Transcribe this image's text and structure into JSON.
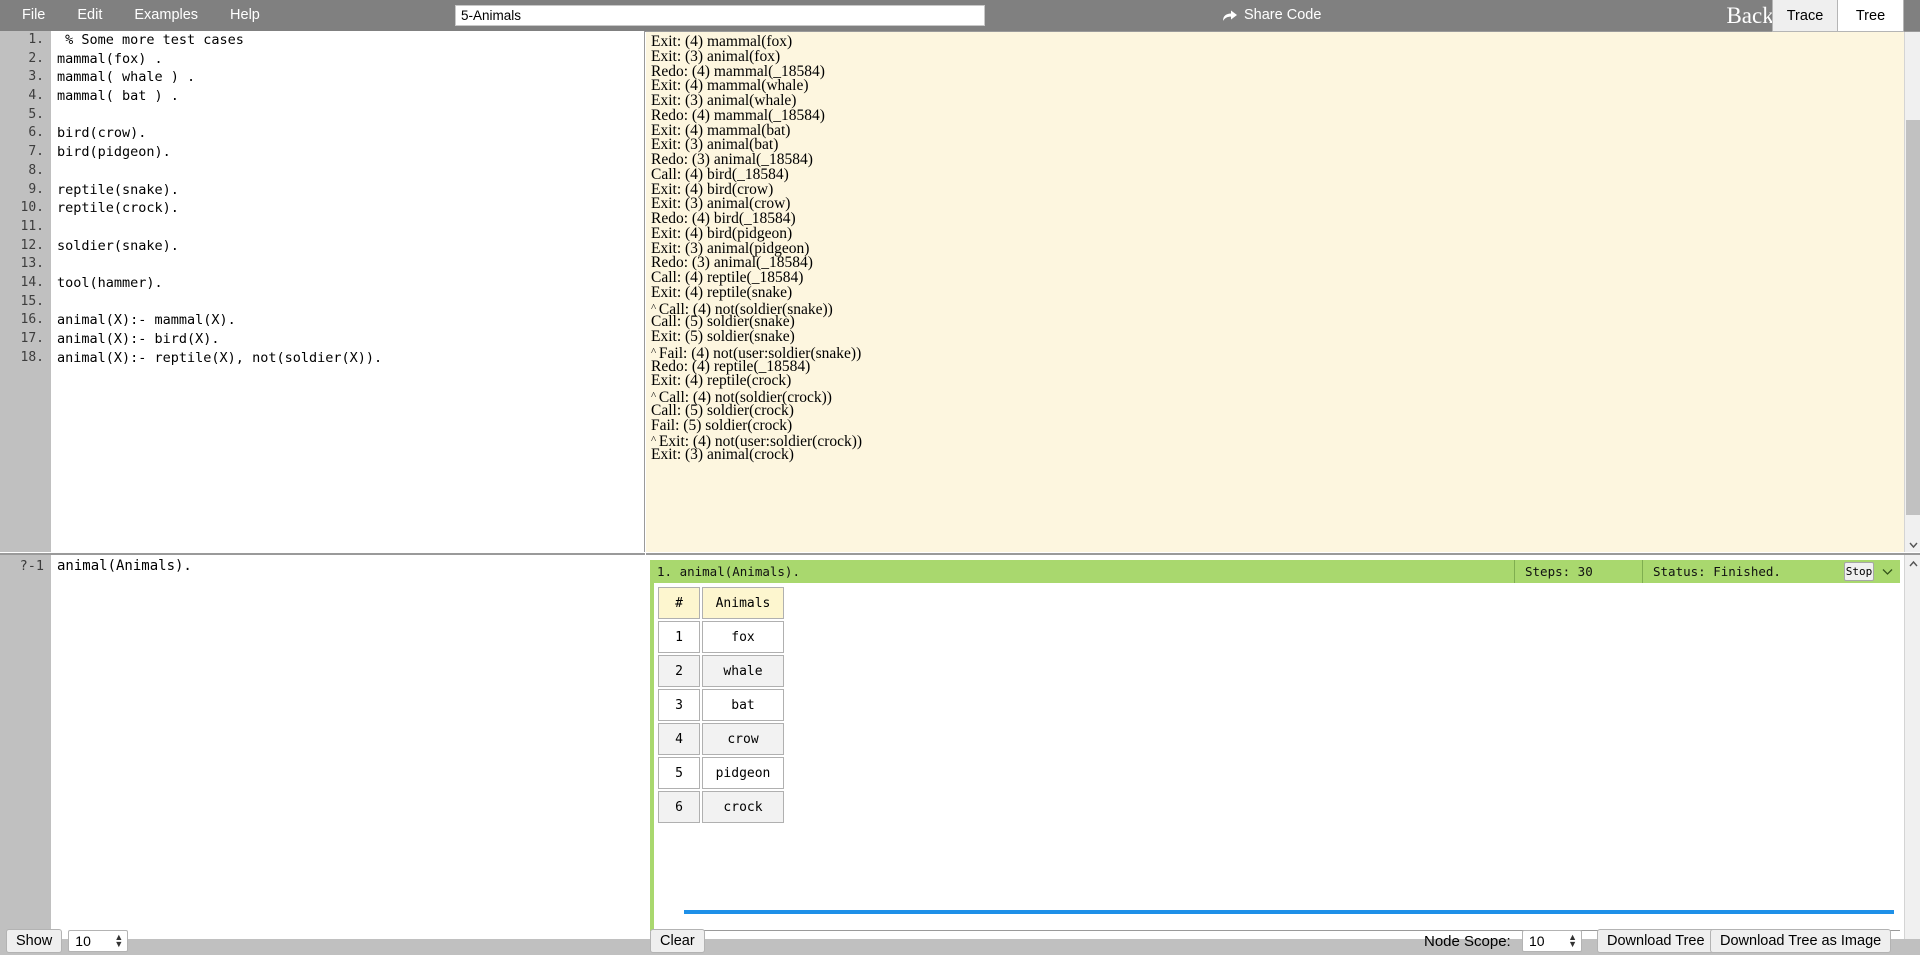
{
  "app": {
    "title": "Backtrace Tools JS"
  },
  "menubar": {
    "items": [
      {
        "label": "File"
      },
      {
        "label": "Edit"
      },
      {
        "label": "Examples"
      },
      {
        "label": "Help"
      }
    ],
    "filename": "5-Animals",
    "filename_placeholder": "",
    "share_label": "Share Code",
    "share_icon": "share-arrow-icon"
  },
  "editor": {
    "lines": [
      {
        "n": "1.",
        "text": " % Some more test cases"
      },
      {
        "n": "2.",
        "text": "mammal(fox) ."
      },
      {
        "n": "3.",
        "text": "mammal( whale ) ."
      },
      {
        "n": "4.",
        "text": "mammal( bat ) ."
      },
      {
        "n": "5.",
        "text": ""
      },
      {
        "n": "6.",
        "text": "bird(crow)."
      },
      {
        "n": "7.",
        "text": "bird(pidgeon)."
      },
      {
        "n": "8.",
        "text": ""
      },
      {
        "n": "9.",
        "text": "reptile(snake)."
      },
      {
        "n": "10.",
        "text": "reptile(crock)."
      },
      {
        "n": "11.",
        "text": ""
      },
      {
        "n": "12.",
        "text": "soldier(snake)."
      },
      {
        "n": "13.",
        "text": ""
      },
      {
        "n": "14.",
        "text": "tool(hammer)."
      },
      {
        "n": "15.",
        "text": ""
      },
      {
        "n": "16.",
        "text": "animal(X):- mammal(X)."
      },
      {
        "n": "17.",
        "text": "animal(X):- bird(X)."
      },
      {
        "n": "18.",
        "text": "animal(X):- reptile(X), not(soldier(X))."
      }
    ]
  },
  "trace": {
    "tabs": [
      {
        "label": "Trace",
        "active": false
      },
      {
        "label": "Tree",
        "active": true
      }
    ],
    "lines": [
      {
        "caret": false,
        "text": "Exit: (4) mammal(fox)"
      },
      {
        "caret": false,
        "text": "Exit: (3) animal(fox)"
      },
      {
        "caret": false,
        "text": "Redo: (4) mammal(_18584)"
      },
      {
        "caret": false,
        "text": "Exit: (4) mammal(whale)"
      },
      {
        "caret": false,
        "text": "Exit: (3) animal(whale)"
      },
      {
        "caret": false,
        "text": "Redo: (4) mammal(_18584)"
      },
      {
        "caret": false,
        "text": "Exit: (4) mammal(bat)"
      },
      {
        "caret": false,
        "text": "Exit: (3) animal(bat)"
      },
      {
        "caret": false,
        "text": "Redo: (3) animal(_18584)"
      },
      {
        "caret": false,
        "text": "Call: (4) bird(_18584)"
      },
      {
        "caret": false,
        "text": "Exit: (4) bird(crow)"
      },
      {
        "caret": false,
        "text": "Exit: (3) animal(crow)"
      },
      {
        "caret": false,
        "text": "Redo: (4) bird(_18584)"
      },
      {
        "caret": false,
        "text": "Exit: (4) bird(pidgeon)"
      },
      {
        "caret": false,
        "text": "Exit: (3) animal(pidgeon)"
      },
      {
        "caret": false,
        "text": "Redo: (3) animal(_18584)"
      },
      {
        "caret": false,
        "text": "Call: (4) reptile(_18584)"
      },
      {
        "caret": false,
        "text": "Exit: (4) reptile(snake)"
      },
      {
        "caret": true,
        "text": "Call: (4) not(soldier(snake))"
      },
      {
        "caret": false,
        "text": "Call: (5) soldier(snake)"
      },
      {
        "caret": false,
        "text": "Exit: (5) soldier(snake)"
      },
      {
        "caret": true,
        "text": "Fail: (4) not(user:soldier(snake))"
      },
      {
        "caret": false,
        "text": "Redo: (4) reptile(_18584)"
      },
      {
        "caret": false,
        "text": "Exit: (4) reptile(crock)"
      },
      {
        "caret": true,
        "text": "Call: (4) not(soldier(crock))"
      },
      {
        "caret": false,
        "text": "Call: (5) soldier(crock)"
      },
      {
        "caret": false,
        "text": "Fail: (5) soldier(crock)"
      },
      {
        "caret": true,
        "text": "Exit: (4) not(user:soldier(crock))"
      },
      {
        "caret": false,
        "text": "Exit: (3) animal(crock)"
      }
    ],
    "caret_glyph": "^"
  },
  "query": {
    "prompt": "?-1",
    "value": "animal(Animals).",
    "placeholder": ""
  },
  "results": {
    "header": {
      "query": "1. animal(Animals).",
      "steps": "Steps: 30",
      "status": "Status: Finished.",
      "stop_label": "Stop",
      "chevron_icon": "chevron-down-icon"
    },
    "table": {
      "columns": [
        "#",
        "Animals"
      ],
      "rows": [
        [
          "1",
          "fox"
        ],
        [
          "2",
          "whale"
        ],
        [
          "3",
          "bat"
        ],
        [
          "4",
          "crow"
        ],
        [
          "5",
          "pidgeon"
        ],
        [
          "6",
          "crock"
        ]
      ]
    }
  },
  "footer": {
    "show_label": "Show",
    "show_count": "10",
    "clear_label": "Clear",
    "node_scope_label": "Node Scope:",
    "node_scope_count": "10",
    "download_tree_label": "Download Tree",
    "download_tree_image_label": "Download Tree as Image"
  },
  "colors": {
    "chrome": "#808080",
    "trace_bg": "#fdf6df",
    "result_green": "#a9d86e",
    "table_header": "#fdf6cf",
    "scroll_blue": "#1e90e8"
  }
}
